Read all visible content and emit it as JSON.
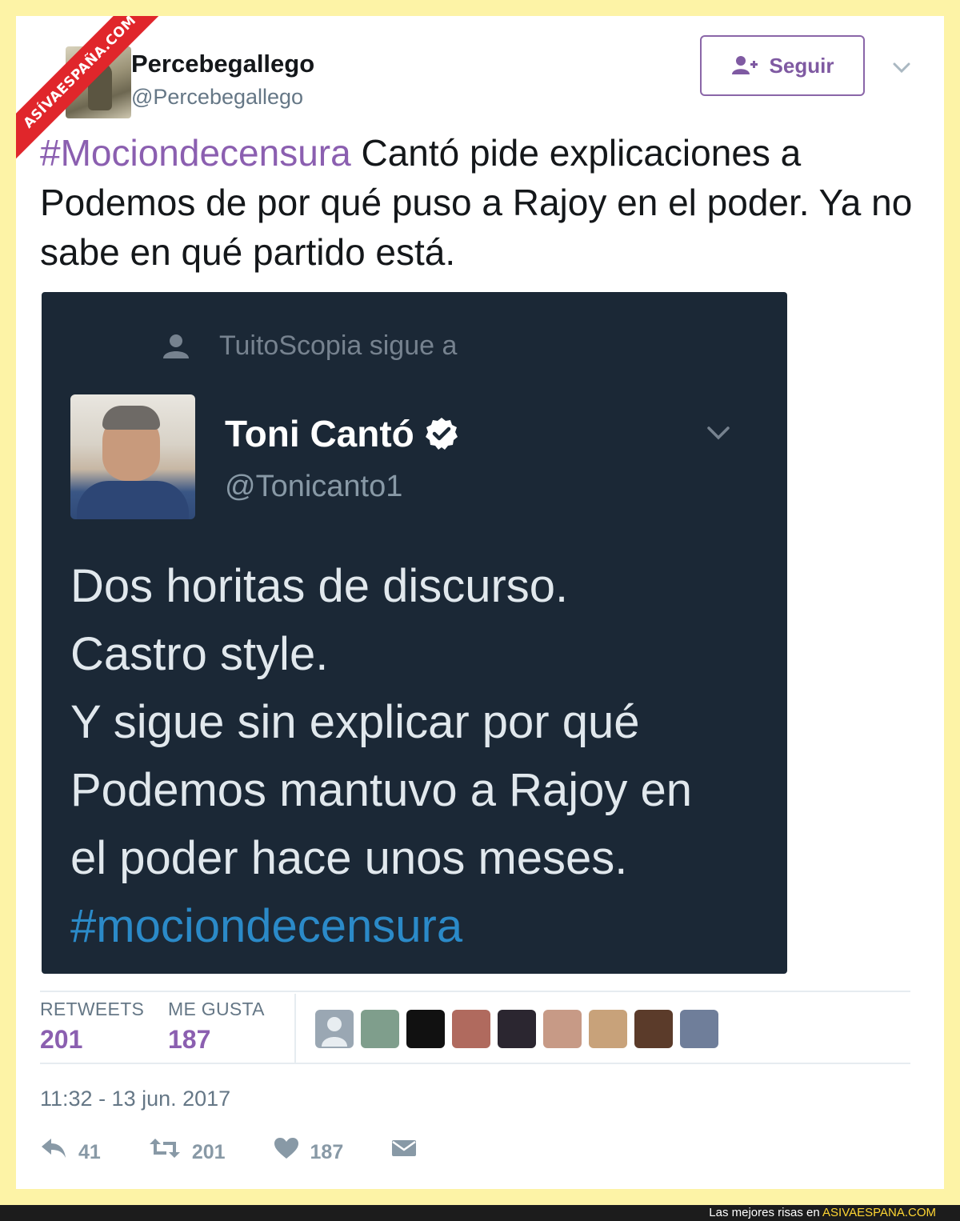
{
  "watermark": {
    "ribbon_text": "ASÍVAESPAÑA.COM"
  },
  "tweet": {
    "user_name": "Percebegallego",
    "user_handle": "@Percebegallego",
    "follow_label": "Seguir",
    "text_hashtag": "#Mociondecensura",
    "text_body": " Cantó pide explicaciones a Podemos de por qué puso a Rajoy en el poder. Ya no sabe en qué partido está."
  },
  "embedded": {
    "follows_text": "TuitoScopia sigue a",
    "author_name": "Toni Cantó",
    "author_handle": "@Tonicanto1",
    "lines": [
      "Dos horitas de discurso.",
      "Castro style.",
      "Y sigue sin explicar por qué",
      "Podemos mantuvo a Rajoy en",
      "el poder hace unos meses."
    ],
    "hashtag": "#mociondecensura"
  },
  "stats": {
    "retweets_label": "RETWEETS",
    "retweets_value": "201",
    "likes_label": "ME GUSTA",
    "likes_value": "187"
  },
  "likers": [
    {
      "icon": "default-avatar-icon",
      "color": "#9aa7b3"
    },
    {
      "icon": "liker-avatar",
      "color": "#7f9e8c"
    },
    {
      "icon": "liker-avatar",
      "color": "#111111"
    },
    {
      "icon": "liker-avatar",
      "color": "#b06a5e"
    },
    {
      "icon": "liker-avatar",
      "color": "#2b2630"
    },
    {
      "icon": "liker-avatar",
      "color": "#c79a86"
    },
    {
      "icon": "liker-avatar",
      "color": "#c8a27a"
    },
    {
      "icon": "liker-avatar",
      "color": "#5b3b2a"
    },
    {
      "icon": "liker-avatar",
      "color": "#6f7e9a"
    }
  ],
  "timestamp": "11:32 - 13 jun. 2017",
  "actions": {
    "reply_count": "41",
    "retweet_count": "201",
    "like_count": "187"
  },
  "footer": {
    "prefix": "Las mejores risas en ",
    "site": "ASIVAESPANA.COM"
  },
  "colors": {
    "accent": "#8b5fb0",
    "embed_bg": "#1b2836",
    "embed_hashtag": "#2b8ac8",
    "page_border": "#fdf3a6"
  }
}
